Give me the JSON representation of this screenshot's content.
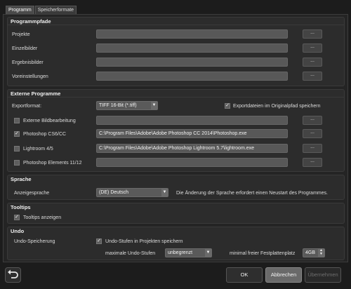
{
  "tabs": [
    "Programm",
    "Speicherformate"
  ],
  "programmpfade": {
    "title": "Programmpfade",
    "rows": [
      {
        "label": "Projekte",
        "value": "",
        "button": "..."
      },
      {
        "label": "Einzelbilder",
        "value": "",
        "button": "..."
      },
      {
        "label": "Ergebnisbilder",
        "value": "",
        "button": "..."
      },
      {
        "label": "Voreinstellungen",
        "value": "",
        "button": "..."
      }
    ]
  },
  "externe": {
    "title": "Externe Programme",
    "exportformat_label": "Exportformat:",
    "exportformat_value": "TIFF 16-Bit (*.tiff)",
    "export_orig_label": "Exportdateien im Originalpfad speichern",
    "export_orig_checked": true,
    "programs": [
      {
        "label": "Externe Bildbearbeitung",
        "checked": false,
        "path": "",
        "button": "..."
      },
      {
        "label": "Photoshop CS6/CC",
        "checked": true,
        "path": "C:\\Program Files\\Adobe\\Adobe Photoshop CC 2014\\Photoshop.exe",
        "button": "..."
      },
      {
        "label": "Lightroom 4/5",
        "checked": false,
        "path": "C:\\Program Files\\Adobe\\Adobe Photoshop Lightroom 5.7\\lightroom.exe",
        "button": "..."
      },
      {
        "label": "Photoshop Elements 11/12",
        "checked": false,
        "path": "",
        "button": "..."
      }
    ]
  },
  "sprache": {
    "title": "Sprache",
    "label": "Anzeigesprache",
    "value": "(DE) Deutsch",
    "note": "Die Änderung der Sprache erfordert einen Neustart des Programmes."
  },
  "tooltips": {
    "title": "Tooltips",
    "label": "Tooltips anzeigen",
    "checked": true
  },
  "undo": {
    "title": "Undo",
    "label": "Undo-Speicherung",
    "save_label": "Undo-Stufen in Projekten speichern",
    "save_checked": true,
    "max_label": "maximale Undo-Stufen",
    "max_value": "unbegrenzt",
    "min_free_label": "minimal freier Festplattenplatz",
    "min_free_value": "4GB"
  },
  "footer": {
    "ok": "OK",
    "cancel": "Abbrechen",
    "apply": "Übernehmen"
  },
  "colors": {
    "background": "#1c1c1c",
    "panel": "#2c2c2c",
    "field": "#585858",
    "cancel_button": "#6a6a6a"
  }
}
